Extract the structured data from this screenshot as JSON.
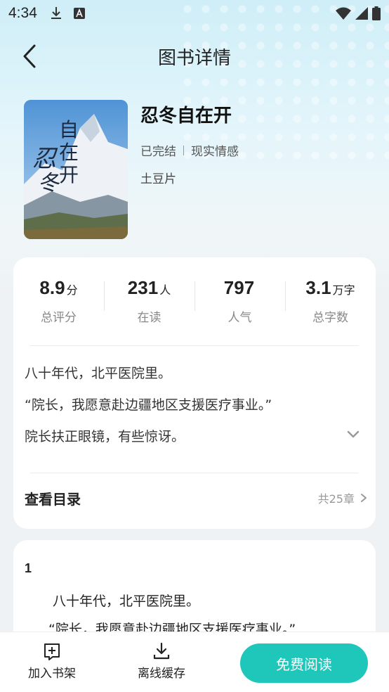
{
  "status_bar": {
    "time": "4:34",
    "icons": [
      "download-icon",
      "a-icon",
      "wifi-icon",
      "signal-icon",
      "battery-icon"
    ]
  },
  "header": {
    "title": "图书详情",
    "back_icon": "chevron-left-icon"
  },
  "book": {
    "title": "忍冬自在开",
    "status": "已完结",
    "genre": "现实情感",
    "author": "土豆片",
    "cover_text_main": "忍冬",
    "cover_text_side": "自在开"
  },
  "stats": [
    {
      "value": "8.9",
      "unit": "分",
      "label": "总评分"
    },
    {
      "value": "231",
      "unit": "人",
      "label": "在读"
    },
    {
      "value": "797",
      "unit": "",
      "label": "人气"
    },
    {
      "value": "3.1",
      "unit": "万字",
      "label": "总字数"
    }
  ],
  "synopsis": [
    "八十年代，北平医院里。",
    "“院长，我愿意赴边疆地区支援医疗事业。”",
    "院长扶正眼镜，有些惊讶。"
  ],
  "toc": {
    "label": "查看目录",
    "count": "共25章"
  },
  "preview": {
    "chapter": "1",
    "lines": [
      "八十年代，北平医院里。",
      "“院长，我愿意赴边疆地区支援医疗事业。”"
    ]
  },
  "bottom_bar": {
    "shelf_label": "加入书架",
    "cache_label": "离线缓存",
    "read_label": "免费阅读"
  },
  "colors": {
    "accent": "#1fc7bb",
    "header_bg": "#cfeef8",
    "page_bg": "#eef2f4"
  }
}
